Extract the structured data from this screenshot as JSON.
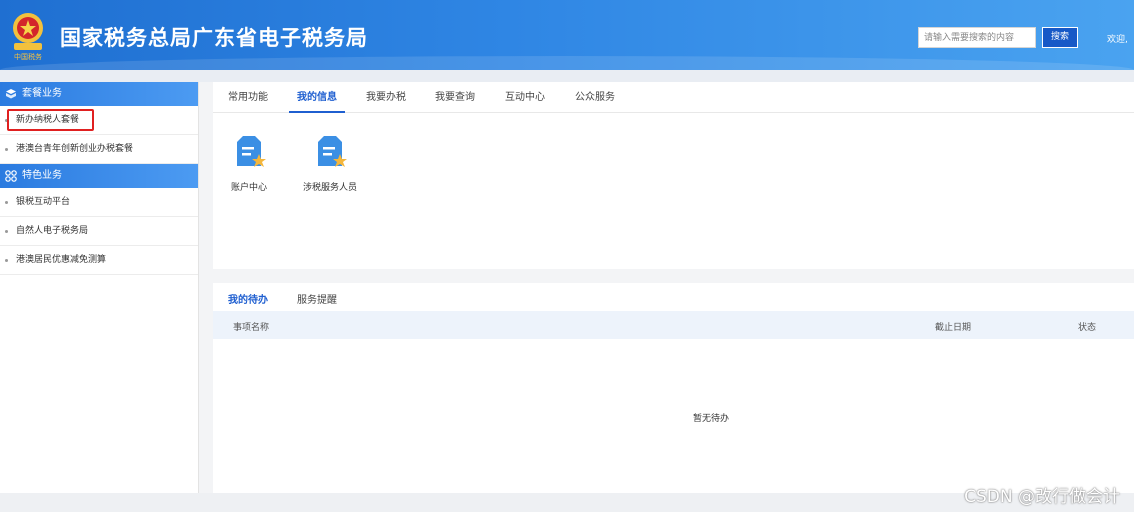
{
  "header": {
    "emblem_caption": "中国税务",
    "title": "国家税务总局广东省电子税务局",
    "search_placeholder": "请输入需要搜索的内容",
    "search_button": "搜索",
    "welcome": "欢迎,"
  },
  "sidebar": {
    "groups": [
      {
        "title": "套餐业务",
        "icon": "cube-icon",
        "items": [
          "新办纳税人套餐",
          "港澳台青年创新创业办税套餐"
        ]
      },
      {
        "title": "特色业务",
        "icon": "grid-icon",
        "items": [
          "银税互动平台",
          "自然人电子税务局",
          "港澳居民优惠减免测算"
        ]
      }
    ],
    "highlight_color": "#e02020"
  },
  "main": {
    "tabs": [
      "常用功能",
      "我的信息",
      "我要办税",
      "我要查询",
      "互动中心",
      "公众服务"
    ],
    "active_tab": "我的信息",
    "apps": [
      {
        "label": "账户中心",
        "icon": "account-center-icon"
      },
      {
        "label": "涉税服务人员",
        "icon": "tax-staff-icon"
      }
    ]
  },
  "todo": {
    "tabs": [
      "我的待办",
      "服务提醒"
    ],
    "active_tab": "我的待办",
    "columns": [
      "事项名称",
      "截止日期",
      "状态"
    ],
    "empty_text": "暂无待办"
  },
  "watermark": "CSDN @改行做会计",
  "colors": {
    "brand": "#1f6fd1",
    "accent": "#1f5fd0",
    "table_header": "#edf3fb"
  }
}
